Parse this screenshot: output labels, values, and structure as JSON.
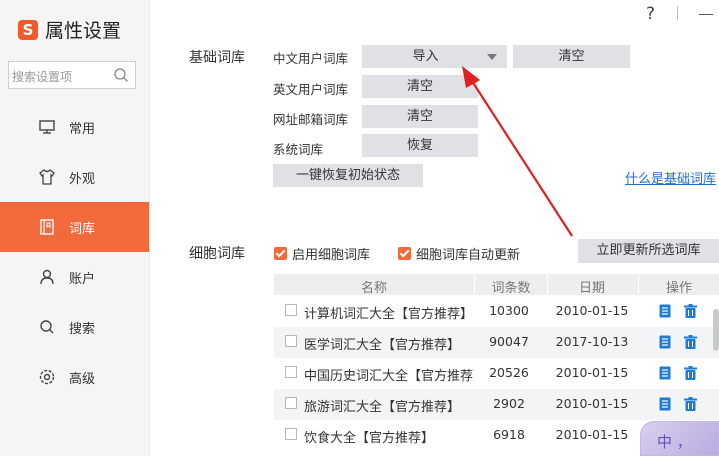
{
  "app": {
    "title": "属性设置",
    "logo": "S"
  },
  "window": {
    "help": "?"
  },
  "sidebar": {
    "search_placeholder": "搜索设置项",
    "items": [
      {
        "label": "常用",
        "icon": "monitor-icon",
        "active": false
      },
      {
        "label": "外观",
        "icon": "shirt-icon",
        "active": false
      },
      {
        "label": "词库",
        "icon": "book-icon",
        "active": true
      },
      {
        "label": "账户",
        "icon": "user-icon",
        "active": false
      },
      {
        "label": "搜索",
        "icon": "search-icon",
        "active": false
      },
      {
        "label": "高级",
        "icon": "gear-icon",
        "active": false
      }
    ]
  },
  "basic": {
    "title": "基础词库",
    "rows": [
      {
        "label": "中文用户词库",
        "button": "导入",
        "button2": "清空"
      },
      {
        "label": "英文用户词库",
        "button": "清空"
      },
      {
        "label": "网址邮箱词库",
        "button": "清空"
      },
      {
        "label": "系统词库",
        "button": "恢复"
      }
    ],
    "reset_button": "一键恢复初始状态",
    "help_link": "什么是基础词库"
  },
  "cell": {
    "title": "细胞词库",
    "enable_label": "启用细胞词库",
    "auto_update_label": "细胞词库自动更新",
    "update_button": "立即更新所选词库",
    "columns": [
      "名称",
      "词条数",
      "日期",
      "操作"
    ],
    "rows": [
      {
        "name": "计算机词汇大全【官方推荐】",
        "count": "10300",
        "date": "2010-01-15"
      },
      {
        "name": "医学词汇大全【官方推荐】",
        "count": "90047",
        "date": "2017-10-13"
      },
      {
        "name": "中国历史词汇大全【官方推荐】",
        "count": "20526",
        "date": "2010-01-15"
      },
      {
        "name": "旅游词汇大全【官方推荐】",
        "count": "2902",
        "date": "2010-01-15"
      },
      {
        "name": "饮食大全【官方推荐】",
        "count": "6918",
        "date": "2010-01-15"
      }
    ]
  },
  "colors": {
    "accent": "#f26a3c",
    "link": "#1d6fd1",
    "annotation_arrow": "#e02020",
    "icon_blue": "#1e7bd8"
  },
  "ime": {
    "glyph": "中 ，"
  }
}
